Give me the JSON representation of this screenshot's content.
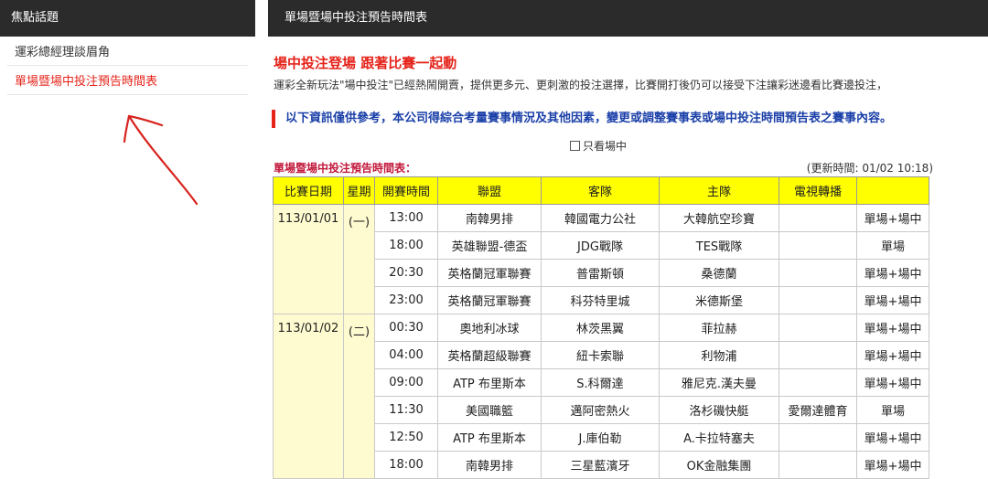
{
  "sidebar": {
    "title": "焦點話題",
    "items": [
      {
        "label": "運彩總經理談眉角"
      },
      {
        "label": "單場暨場中投注預告時間表"
      }
    ]
  },
  "main": {
    "header": "單場暨場中投注預告時間表",
    "promo_title": "場中投注登場 跟著比賽一起動",
    "promo_text": "運彩全新玩法\"場中投注\"已經熱鬧開賣，提供更多元、更刺激的投注選擇，比賽開打後仍可以接受下注讓彩迷邊看比賽邊投注，",
    "notice": "以下資訊僅供參考，本公司得綜合考量賽事情況及其他因素，變更或調整賽事表或場中投注時間預告表之賽事內容。",
    "only_live_label": "只看場中",
    "table_title": "單場暨場中投注預告時間表：",
    "update_time": "(更新時間: 01/02 10:18)",
    "columns": [
      "比賽日期",
      "星期",
      "開賽時間",
      "聯盟",
      "客隊",
      "主隊",
      "電視轉播",
      ""
    ],
    "days": [
      {
        "date": "113/01/01",
        "weekday": "(一)",
        "rows": [
          {
            "time": "13:00",
            "league": "南韓男排",
            "away": "韓國電力公社",
            "home": "大韓航空珍寶",
            "tv": "",
            "type": "單場+場中"
          },
          {
            "time": "18:00",
            "league": "英雄聯盟-德盃",
            "away": "JDG戰隊",
            "home": "TES戰隊",
            "tv": "",
            "type": "單場"
          },
          {
            "time": "20:30",
            "league": "英格蘭冠軍聯賽",
            "away": "普雷斯頓",
            "home": "桑德蘭",
            "tv": "",
            "type": "單場+場中"
          },
          {
            "time": "23:00",
            "league": "英格蘭冠軍聯賽",
            "away": "科芬特里城",
            "home": "米德斯堡",
            "tv": "",
            "type": "單場+場中"
          }
        ]
      },
      {
        "date": "113/01/02",
        "weekday": "(二)",
        "rows": [
          {
            "time": "00:30",
            "league": "奧地利冰球",
            "away": "林茨黑翼",
            "home": "菲拉赫",
            "tv": "",
            "type": "單場+場中"
          },
          {
            "time": "04:00",
            "league": "英格蘭超級聯賽",
            "away": "紐卡索聯",
            "home": "利物浦",
            "tv": "",
            "type": "單場+場中"
          },
          {
            "time": "09:00",
            "league": "ATP 布里斯本",
            "away": "S.科爾達",
            "home": "雅尼克.漢夫曼",
            "tv": "",
            "type": "單場+場中"
          },
          {
            "time": "11:30",
            "league": "美國職籃",
            "away": "邁阿密熱火",
            "home": "洛杉磯快艇",
            "tv": "愛爾達體育",
            "type": "單場"
          },
          {
            "time": "12:50",
            "league": "ATP 布里斯本",
            "away": "J.庫伯勒",
            "home": "A.卡拉特塞夫",
            "tv": "",
            "type": "單場+場中"
          },
          {
            "time": "18:00",
            "league": "南韓男排",
            "away": "三星藍濱牙",
            "home": "OK金融集團",
            "tv": "",
            "type": "單場+場中"
          }
        ]
      }
    ]
  }
}
